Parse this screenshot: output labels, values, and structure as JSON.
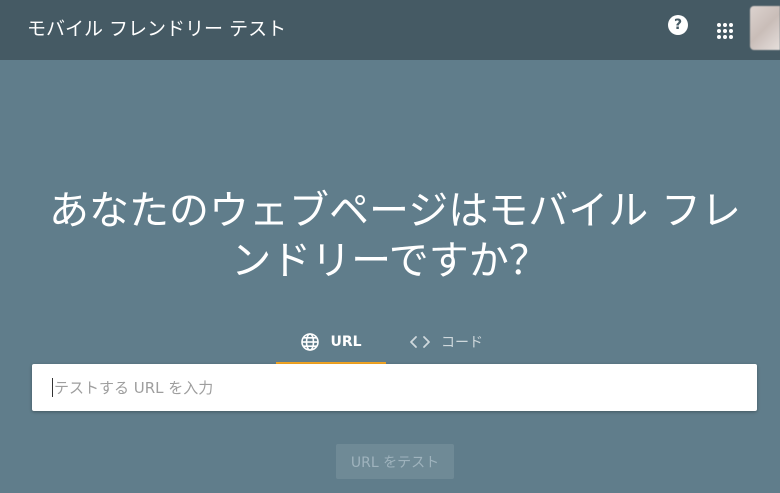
{
  "header": {
    "title": "モバイル フレンドリー テスト",
    "help_icon": "help-circle-icon",
    "help_glyph": "?",
    "apps_icon": "apps-grid-icon",
    "avatar": "user-avatar"
  },
  "hero": {
    "line1": "あなたのウェブページはモバイル フレ",
    "line2": "ンドリーですか？"
  },
  "tabs": [
    {
      "label": "URL",
      "icon": "globe-icon",
      "selected": true
    },
    {
      "label": "コード",
      "icon": "code-brackets-icon",
      "selected": false
    }
  ],
  "search": {
    "placeholder": "テストする URL を入力",
    "value": ""
  },
  "actions": {
    "test_label": "URL をテスト",
    "enabled": false
  },
  "colors": {
    "header_bg": "#455a64",
    "page_bg": "#607d8b",
    "tab_indicator": "#f5a623",
    "button_bg": "#6f8a96"
  }
}
